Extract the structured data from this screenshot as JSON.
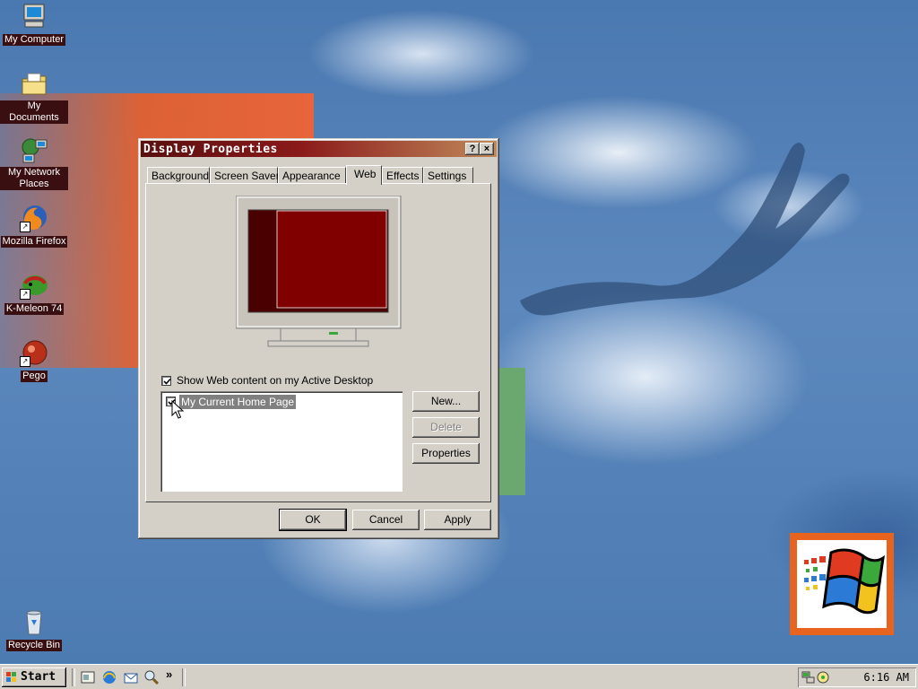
{
  "desktop": {
    "icons": [
      {
        "label": "My Computer",
        "icon": "computer-icon"
      },
      {
        "label": "My Documents",
        "icon": "folder-icon"
      },
      {
        "label": "My Network Places",
        "icon": "network-icon"
      },
      {
        "label": "Mozilla Firefox",
        "icon": "firefox-icon",
        "shortcut": true
      },
      {
        "label": "K-Meleon 74",
        "icon": "kmeleon-icon",
        "shortcut": true
      },
      {
        "label": "Pego",
        "icon": "pego-icon",
        "shortcut": true
      },
      {
        "label": "Recycle Bin",
        "icon": "recycle-bin-icon"
      }
    ]
  },
  "window": {
    "title": "Display Properties",
    "help_label": "?",
    "close_label": "×",
    "tabs": [
      "Background",
      "Screen Saver",
      "Appearance",
      "Web",
      "Effects",
      "Settings"
    ],
    "active_tab": "Web",
    "show_web_content_label": "Show Web content on my Active Desktop",
    "show_web_content_checked": true,
    "web_items": [
      {
        "label": "My Current Home Page",
        "checked": true
      }
    ],
    "side_buttons": {
      "new": "New...",
      "delete": "Delete",
      "properties": "Properties"
    },
    "footer_buttons": {
      "ok": "OK",
      "cancel": "Cancel",
      "apply": "Apply"
    }
  },
  "taskbar": {
    "start_label": "Start",
    "more_label": "»",
    "clock": "6:16 AM"
  },
  "colors": {
    "title_gradient_start": "#5a0f0f",
    "preview_red": "#800000",
    "preview_dark": "#4a0000",
    "desktop_blue": "#4a78b0",
    "orange": "#e8643a",
    "selection": "#808080"
  }
}
